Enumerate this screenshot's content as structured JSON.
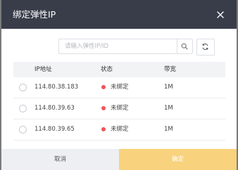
{
  "dialog": {
    "title": "绑定弹性IP"
  },
  "search": {
    "placeholder": "请输入弹性IP/ID",
    "value": ""
  },
  "table": {
    "columns": [
      "IP地址",
      "状态",
      "带宽"
    ],
    "rows": [
      {
        "ip": "114.80.38.183",
        "status": "未绑定",
        "bandwidth": "1M"
      },
      {
        "ip": "114.80.39.63",
        "status": "未绑定",
        "bandwidth": "1M"
      },
      {
        "ip": "114.80.39.65",
        "status": "未绑定",
        "bandwidth": "1M"
      }
    ]
  },
  "footer": {
    "cancel_label": "取消",
    "confirm_label": "确定"
  },
  "colors": {
    "header_bg": "#383d49",
    "status_unbound": "#f0545a",
    "confirm_bg": "#f9d27d"
  },
  "icons": {
    "close": "close-icon",
    "search": "search-icon",
    "refresh": "refresh-icon"
  }
}
